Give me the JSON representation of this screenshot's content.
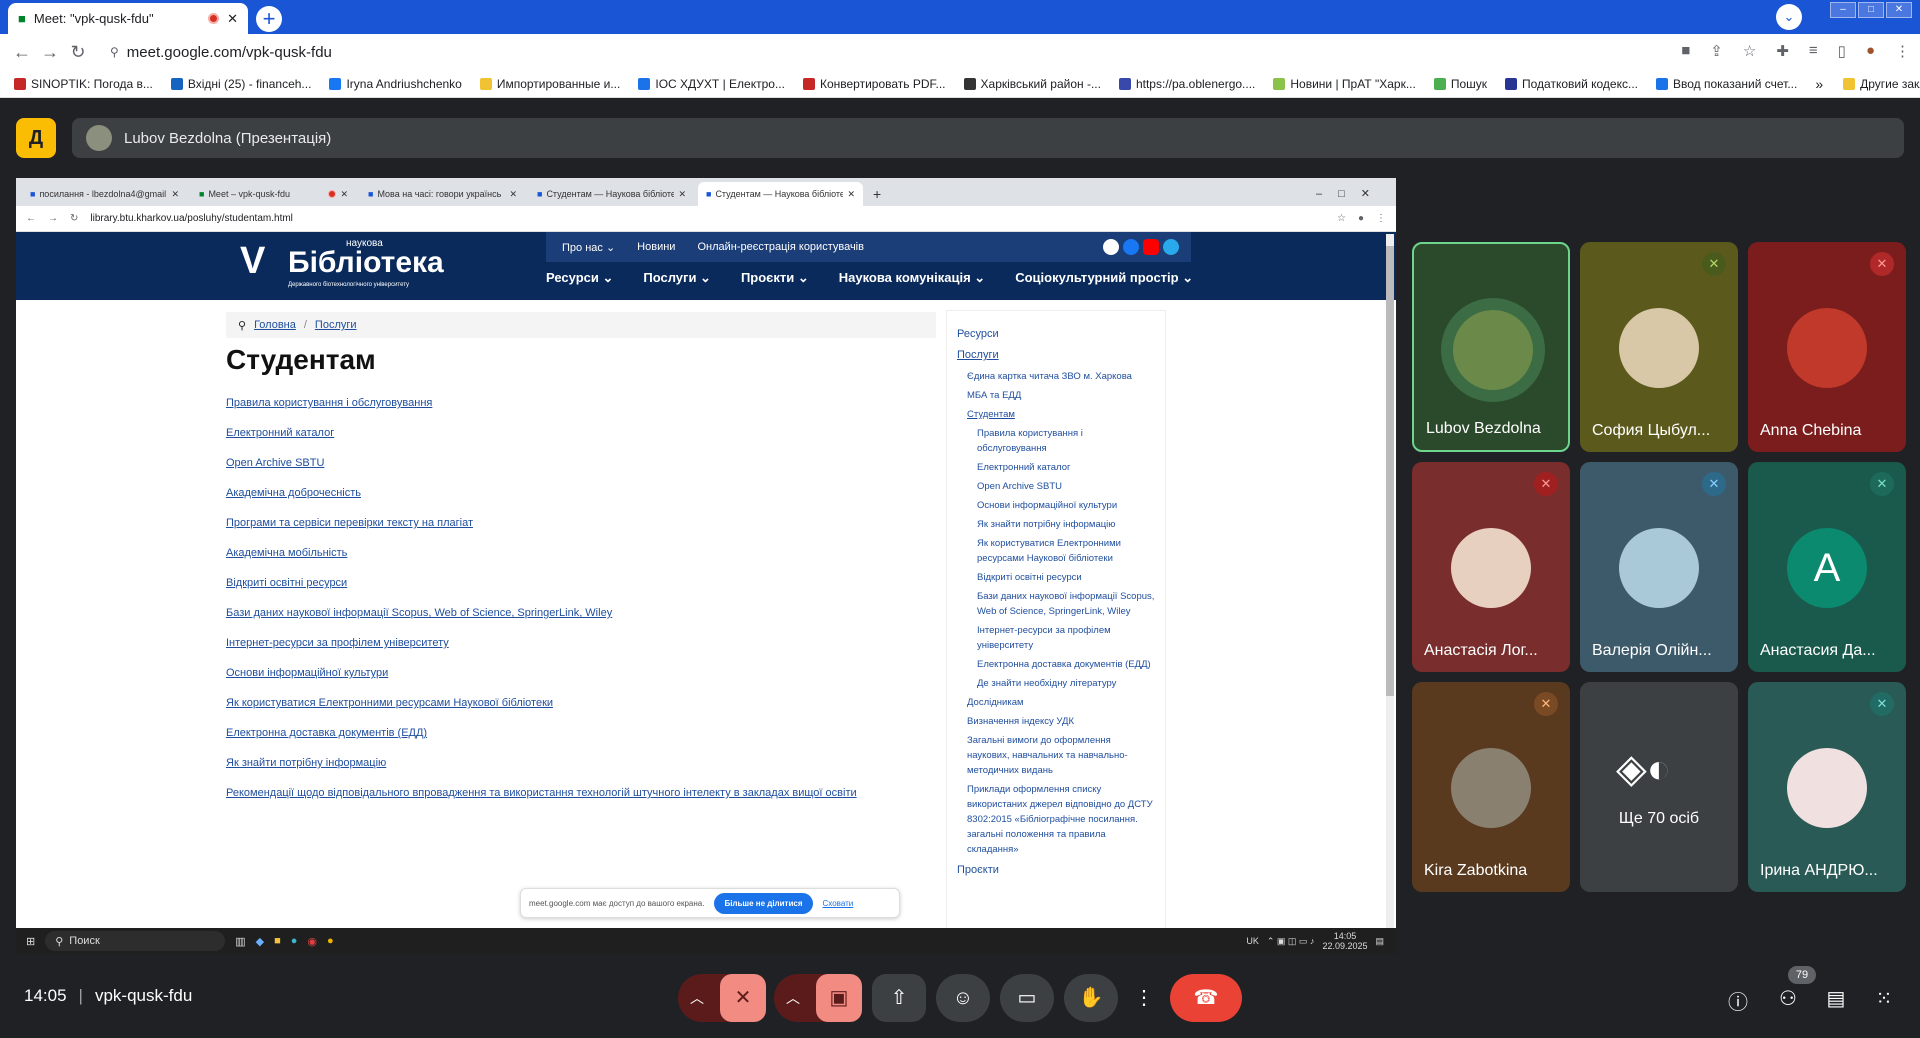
{
  "browser": {
    "tab_title": "Meet: \"vpk-qusk-fdu\"",
    "url": "meet.google.com/vpk-qusk-fdu"
  },
  "bookmarks": [
    "SINOPTIK: Погода в...",
    "Вхідні (25) - financeh...",
    "Iryna Andriushchenko",
    "Импортированные и...",
    "ІОС ХДУХТ | Електро...",
    "Конвертировать PDF...",
    "Харківський район -...",
    "https://pa.oblenergo....",
    "Новини | ПрАТ \"Харк...",
    "Пошук",
    "Податковий кодекс...",
    "Ввод показаний счет..."
  ],
  "bookmarks_more": "»",
  "bookmarks_other": "Другие закладки",
  "presentation": {
    "title": "Lubov Bezdolna (Презентація)"
  },
  "inner": {
    "tabs": [
      "посилання - lbezdolna4@gmail",
      "Meet – vpk-qusk-fdu",
      "Мова на часі: говори українсь",
      "Студентам — Наукова бібліоте",
      "Студентам — Наукова бібліоте"
    ],
    "url": "library.btu.kharkov.ua/posluhy/studentam.html",
    "logo": {
      "top": "наукова",
      "main": "Бібліотека",
      "sub": "Державного біотехнологічного університету"
    },
    "top_menu": [
      "Про нас ⌄",
      "Новини",
      "Онлайн-реєстрація користувачів"
    ],
    "main_menu": [
      "Ресурси ⌄",
      "Послуги ⌄",
      "Проєкти ⌄",
      "Наукова комунікація ⌄",
      "Соціокультурний простір ⌄"
    ],
    "breadcrumb": [
      "Головна",
      "/",
      "Послуги"
    ],
    "heading": "Студентам",
    "links": [
      "Правила користування і обслуговування",
      "Електронний каталог",
      "Open Archive SBTU",
      "Академічна доброчесність",
      "Програми та сервіси перевірки тексту на плагіат",
      "Академічна мобільність",
      "Відкриті освітні ресурси",
      "Бази даних наукової інформації Scopus, Web of Science, SpringerLink, Wiley",
      "Інтернет-ресурси за профілем університету",
      "Основи інформаційної культури",
      "Як користуватися Електронними ресурсами Наукової бібліотеки",
      "Електронна доставка документів (ЕДД)",
      "Як знайти потрібну інформацію",
      "Рекомендації щодо відповідального впровадження та використання технологій штучного інтелекту в закладах вищої освіти"
    ],
    "sidebar": {
      "s1": [
        "Ресурси",
        "Послуги"
      ],
      "s2a": [
        "Єдина картка читача ЗВО м. Харкова",
        "МБА та ЕДД",
        "Студентам"
      ],
      "s3": [
        "Правила користування і обслуговування",
        "Електронний каталог",
        "Open Archive SBTU",
        "Основи інформаційної культури",
        "Як знайти потрібну інформацію",
        "Як користуватися Електронними ресурсами Наукової бібліотеки",
        "Відкриті освітні ресурси",
        "Бази даних наукової інформації Scopus, Web of Science, SpringerLink, Wiley",
        "Інтернет-ресурси за профілем університету",
        "Електронна доставка документів (ЕДД)",
        "Де знайти необхідну літературу"
      ],
      "s2b": [
        "Дослідникам",
        "Визначення індексу УДК",
        "Загальні вимоги до оформлення наукових, навчальних та навчально-методичних видань",
        "Приклади оформлення списку використаних джерел відповідно до ДСТУ 8302:2015 «Бібліографічне посилання. загальні положення та правила складання»"
      ],
      "s1b": "Проєкти"
    },
    "share": {
      "text": "meet.google.com має доступ до вашого екрана.",
      "stop": "Більше не ділитися",
      "hide": "Сховати"
    },
    "taskbar": {
      "search": "Поиск",
      "lang": "UK",
      "time": "14:05",
      "date": "22.09.2025"
    }
  },
  "participants": [
    {
      "name": "Lubov Bezdolna",
      "bg": "#2b4a2b"
    },
    {
      "name": "София Цыбул...",
      "bg": "#5b5a1c"
    },
    {
      "name": "Anna Chebina",
      "bg": "#7c1d1d"
    },
    {
      "name": "Анастасія Лог...",
      "bg": "#7a2d2d"
    },
    {
      "name": "Валерія Олійн...",
      "bg": "#3d5a6b"
    },
    {
      "name": "Анастасия Да...",
      "bg": "#1a5a4d"
    },
    {
      "name": "Kira Zabotkina",
      "bg": "#5a3a1e"
    },
    {
      "name": "Ще 70 осіб",
      "bg": "#3c4043"
    },
    {
      "name": "Ірина АНДРЮ...",
      "bg": "#2a5a55"
    }
  ],
  "avatar_letter": "A",
  "footer": {
    "time": "14:05",
    "code": "vpk-qusk-fdu",
    "count": "79"
  }
}
